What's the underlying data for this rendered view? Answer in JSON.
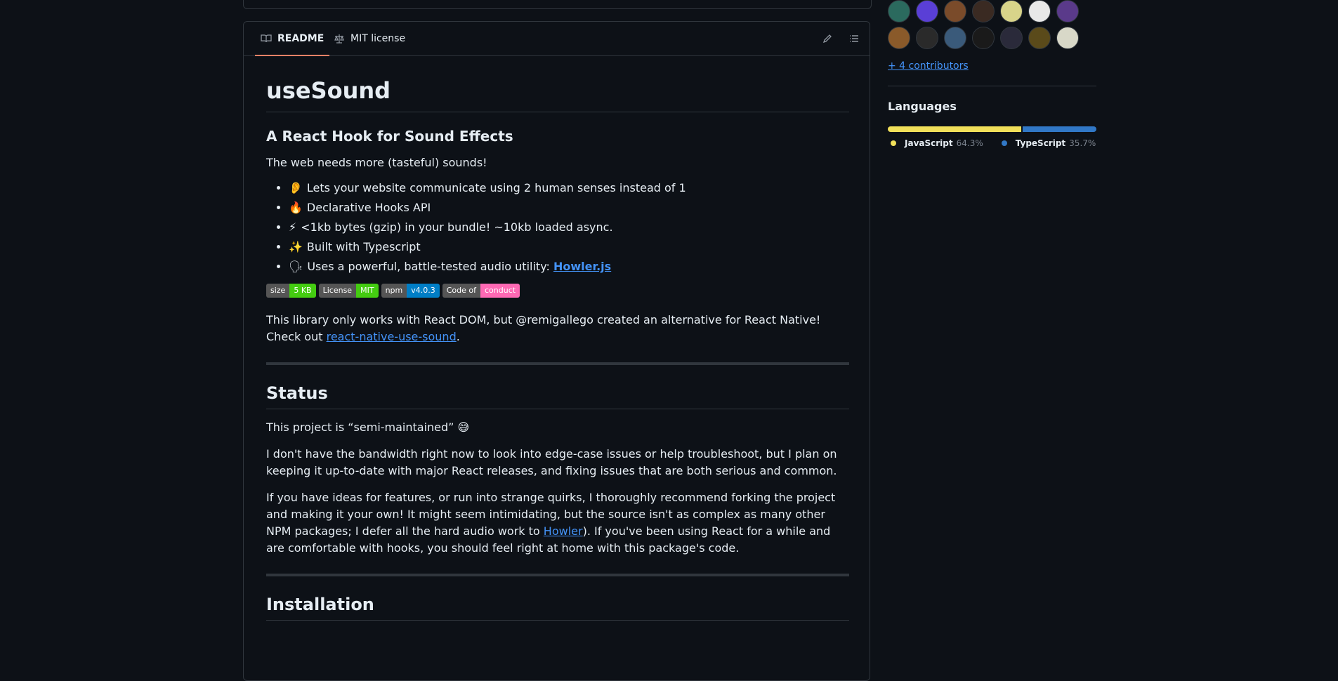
{
  "readme_tabs": {
    "readme": "README",
    "license": "MIT license"
  },
  "readme": {
    "title": "useSound",
    "subtitle": "A React Hook for Sound Effects",
    "intro": "The web needs more (tasteful) sounds!",
    "features": [
      {
        "emoji": "👂",
        "text": "Lets your website communicate using 2 human senses instead of 1"
      },
      {
        "emoji": "🔥",
        "text": "Declarative Hooks API"
      },
      {
        "emoji": "⚡",
        "text": "<1kb bytes (gzip) in your bundle! ~10kb loaded async."
      },
      {
        "emoji": "✨",
        "text": "Built with Typescript"
      },
      {
        "emoji": "🗣",
        "text": "Uses a powerful, battle-tested audio utility: ",
        "link": "Howler.js"
      }
    ],
    "badges": [
      {
        "label": "size",
        "value": "5 KB",
        "color": "#4c1"
      },
      {
        "label": "License",
        "value": "MIT",
        "color": "#4c1"
      },
      {
        "label": "npm",
        "value": "v4.0.3",
        "color": "#007ec6"
      },
      {
        "label": "Code of",
        "value": "conduct",
        "color": "#ff69b4"
      }
    ],
    "native_note": "This library only works with React DOM, but @remigallego created an alternative for React Native! Check out ",
    "native_link": "react-native-use-sound",
    "native_end": ".",
    "status_heading": "Status",
    "status_p1": "This project is “semi-maintained” 😅",
    "status_p2": "I don't have the bandwidth right now to look into edge-case issues or help troubleshoot, but I plan on keeping it up-to-date with major React releases, and fixing issues that are both serious and common.",
    "status_p3_a": "If you have ideas for features, or run into strange quirks, I thoroughly recommend forking the project and making it your own! It might seem intimidating, but the source isn't as complex as many other NPM packages; I defer all the hard audio work to ",
    "status_p3_link": "Howler",
    "status_p3_b": "). If you've been using React for a while and are comfortable with hooks, you should feel right at home with this package's code.",
    "install_heading": "Installation"
  },
  "sidebar": {
    "more_contributors": "+ 4 contributors",
    "languages_title": "Languages",
    "languages": [
      {
        "name": "JavaScript",
        "pct": "64.3%",
        "value": 64.3,
        "color": "#f1e05a"
      },
      {
        "name": "TypeScript",
        "pct": "35.7%",
        "value": 35.7,
        "color": "#3178c6"
      }
    ],
    "avatar_colors": [
      "#2b6a5e",
      "#5a3fd6",
      "#7a4b2a",
      "#3a2a22",
      "#d8d48a",
      "#e8e8e8",
      "#5a3a8a",
      "#8a5a2a",
      "#2a2a2a",
      "#3a5a7a",
      "#1a1a1a",
      "#2a2a3a",
      "#5a4a1a",
      "#d8d8c8"
    ]
  },
  "colors": {
    "accent_link": "#4493f8",
    "tab_underline": "#f78166"
  }
}
